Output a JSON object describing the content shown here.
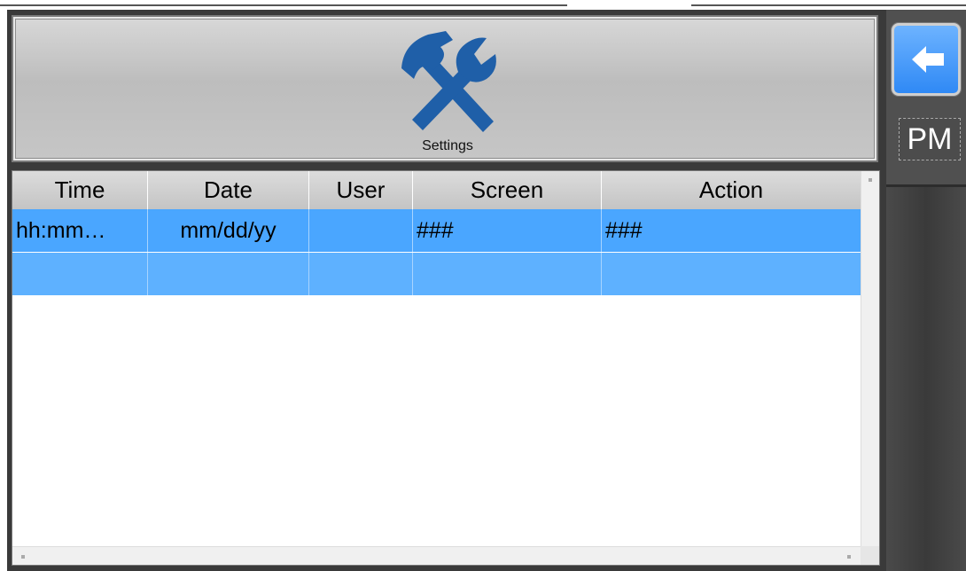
{
  "header": {
    "settings_label": "Settings",
    "settings_icon": "tools-icon",
    "icon_color": "#1f5fa8"
  },
  "table": {
    "columns": [
      "Time",
      "Date",
      "User",
      "Screen",
      "Action"
    ],
    "rows": [
      [
        "hh:mm…",
        "mm/dd/yy",
        "",
        "###",
        "###"
      ],
      [
        "",
        "",
        "",
        "",
        ""
      ]
    ],
    "selected_row_color": "#4aa6ff"
  },
  "side": {
    "back_icon": "arrow-left-icon",
    "ampm": "PM",
    "accent": "#2f89f5"
  }
}
